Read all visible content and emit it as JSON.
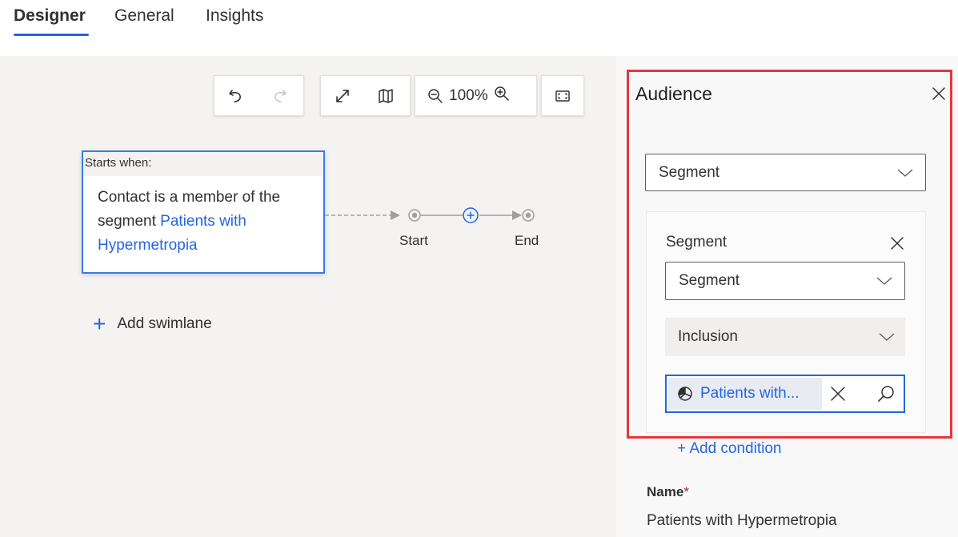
{
  "tabs": [
    {
      "label": "Designer",
      "active": true
    },
    {
      "label": "General",
      "active": false
    },
    {
      "label": "Insights",
      "active": false
    }
  ],
  "toolbar": {
    "zoom_level": "100%",
    "icons": [
      "undo-icon",
      "redo-icon",
      "expand-icon",
      "map-icon",
      "zoom-out-icon",
      "zoom-in-icon",
      "fit-screen-icon"
    ]
  },
  "trigger": {
    "header": "Starts when:",
    "text_prefix": "Contact is a member of the segment ",
    "segment_link": "Patients with Hypermetropia"
  },
  "flow": {
    "start_label": "Start",
    "end_label": "End"
  },
  "add_swimlane": "Add swimlane",
  "panel": {
    "title": "Audience",
    "audience_type": "Segment",
    "segment_group": {
      "label": "Segment",
      "source_select": "Segment",
      "inclusion_select": "Inclusion",
      "selected_segment": "Patients with..."
    },
    "add_condition": "+ Add condition",
    "name_label": "Name",
    "name_required_marker": "*",
    "name_value": "Patients with Hypermetropia"
  },
  "colors": {
    "accent": "#2266e3",
    "highlight_border": "#e5363d",
    "canvas_bg": "#f4f3f2"
  }
}
